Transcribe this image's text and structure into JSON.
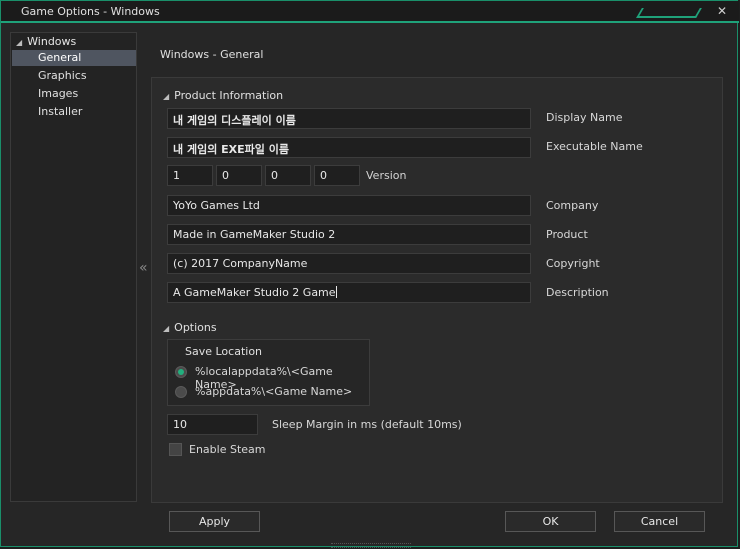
{
  "window": {
    "title": "Game Options - Windows",
    "close_glyph": "✕"
  },
  "sidebar": {
    "root": "Windows",
    "items": [
      {
        "label": "General",
        "selected": true
      },
      {
        "label": "Graphics",
        "selected": false
      },
      {
        "label": "Images",
        "selected": false
      },
      {
        "label": "Installer",
        "selected": false
      }
    ],
    "collapse_glyph": "«"
  },
  "page": {
    "heading": "Windows - General"
  },
  "product_info": {
    "title": "Product Information",
    "display_name": {
      "value": "내 게임의 디스플레이 이름",
      "label": "Display Name"
    },
    "executable_name": {
      "value": "내 게임의 EXE파일 이름",
      "label": "Executable Name"
    },
    "version": {
      "parts": [
        "1",
        "0",
        "0",
        "0"
      ],
      "label": "Version"
    },
    "company": {
      "value": "YoYo Games Ltd",
      "label": "Company"
    },
    "product": {
      "value": "Made in GameMaker Studio 2",
      "label": "Product"
    },
    "copyright": {
      "value": "(c) 2017 CompanyName",
      "label": "Copyright"
    },
    "description": {
      "value": "A GameMaker Studio 2 Game",
      "label": "Description"
    }
  },
  "options": {
    "title": "Options",
    "save_location": {
      "title": "Save Location",
      "choices": [
        {
          "label": "%localappdata%\\<Game Name>",
          "selected": true
        },
        {
          "label": "%appdata%\\<Game Name>",
          "selected": false
        }
      ]
    },
    "sleep_margin": {
      "value": "10",
      "label": "Sleep Margin in ms (default 10ms)"
    },
    "enable_steam": {
      "label": "Enable Steam",
      "checked": false
    }
  },
  "buttons": {
    "apply": "Apply",
    "ok": "OK",
    "cancel": "Cancel"
  },
  "colors": {
    "accent": "#1fa27a",
    "selection": "#4f5560",
    "radio_on": "#22b07e"
  }
}
